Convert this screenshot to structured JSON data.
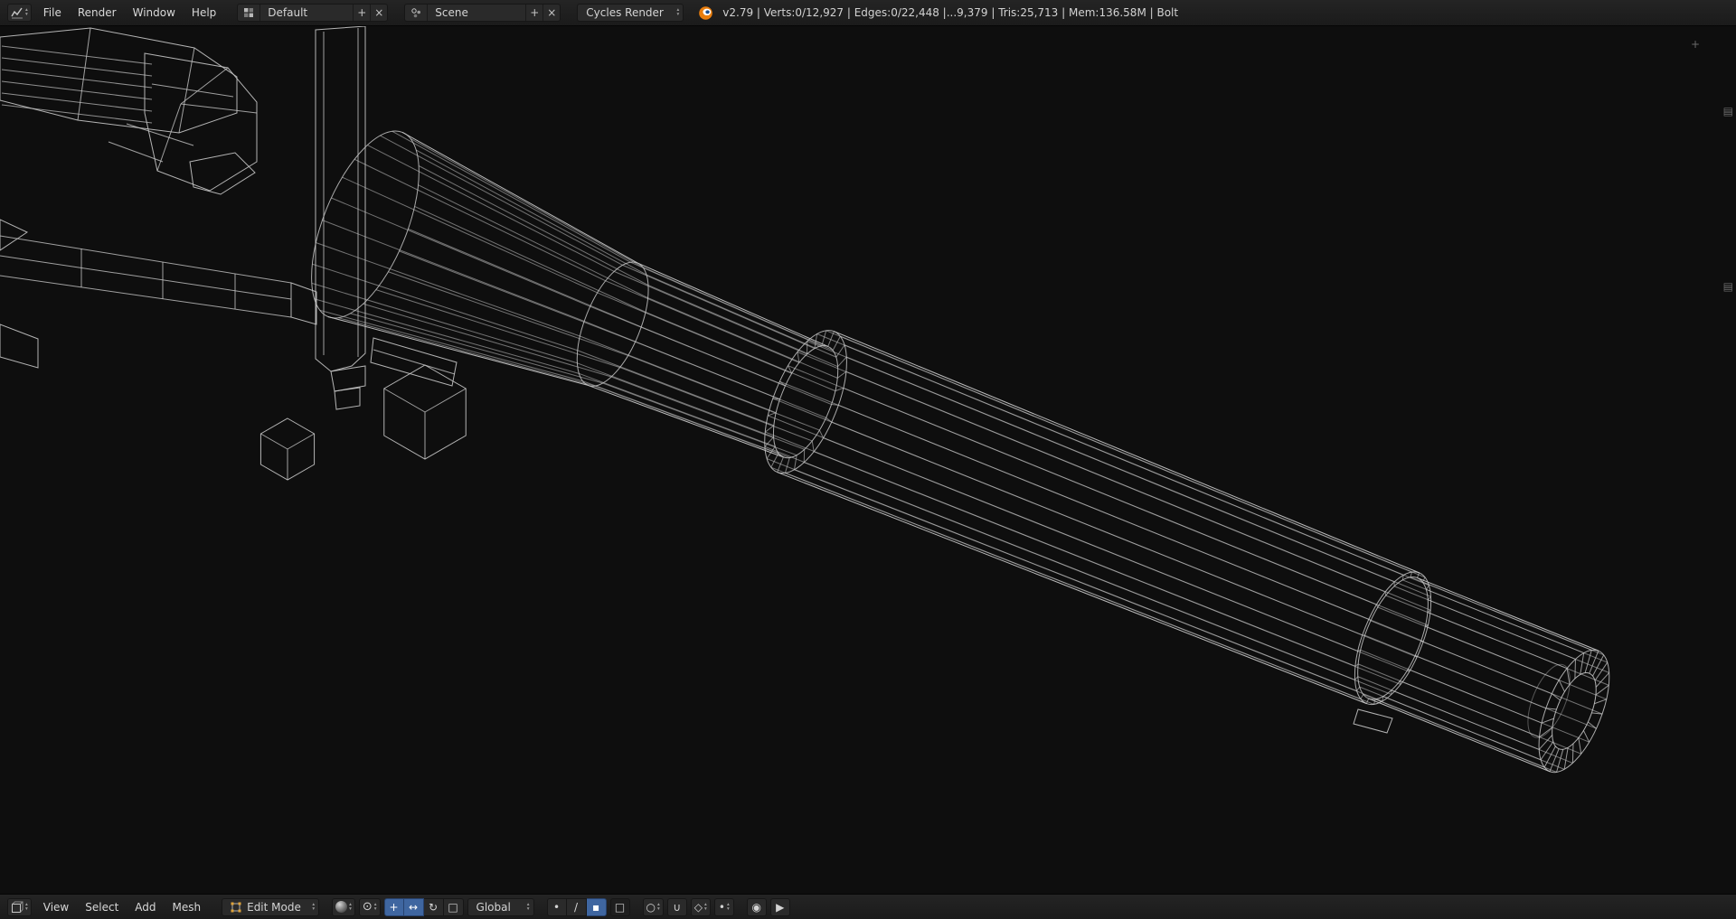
{
  "header": {
    "menus": [
      "File",
      "Render",
      "Window",
      "Help"
    ],
    "screen_layout": {
      "value": "Default",
      "add_label": "+",
      "close_label": "×"
    },
    "scene": {
      "value": "Scene",
      "add_label": "+",
      "close_label": "×"
    },
    "render_engine": {
      "value": "Cycles Render"
    },
    "stats": "v2.79 | Verts:0/12,927 | Edges:0/22,448 |...9,379 | Tris:25,713 | Mem:136.58M | Bolt"
  },
  "footer": {
    "menus": [
      "View",
      "Select",
      "Add",
      "Mesh"
    ],
    "mode": "Edit Mode",
    "orientation": "Global"
  },
  "icons": {
    "pivot": "⊙",
    "hand": "+",
    "translate": "↔",
    "rotate": "↻",
    "scale": "□",
    "vertex": "•",
    "edge": "/",
    "face": "▪",
    "occlude": "□",
    "proportional": "○",
    "magnet": "∪",
    "snap_element": "◇",
    "snap_target": "•",
    "render_still": "◉",
    "render_anim": "▶",
    "expand_plus": "+",
    "region_tab": "▤"
  },
  "colors": {
    "accent": "#4772b3",
    "logo_orange": "#e87d0d",
    "wire": "#c6c6c6"
  }
}
